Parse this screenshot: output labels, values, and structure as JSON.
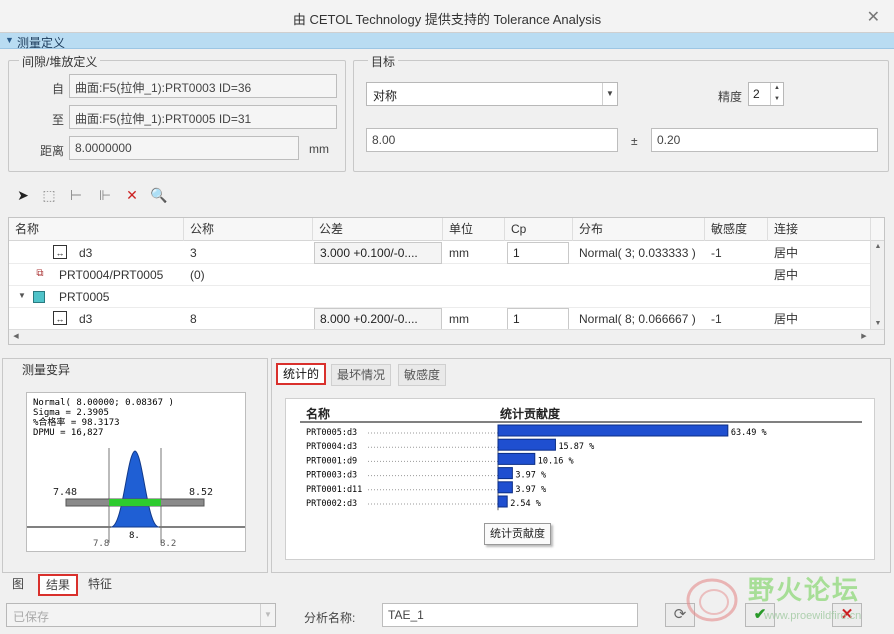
{
  "window": {
    "title": "由 CETOL Technology 提供支持的 Tolerance Analysis",
    "close": "✕"
  },
  "section": {
    "label": "测量定义"
  },
  "gap_def": {
    "legend": "间隙/堆放定义",
    "from_label": "自",
    "from_value": "曲面:F5(拉伸_1):PRT0003 ID=36",
    "to_label": "至",
    "to_value": "曲面:F5(拉伸_1):PRT0005 ID=31",
    "dist_label": "距离",
    "dist_value": "8.0000000",
    "dist_unit": "mm"
  },
  "target": {
    "legend": "目标",
    "mode": "对称",
    "precision_label": "精度",
    "precision_value": "2",
    "nominal": "8.00",
    "pm": "±",
    "tol": "0.20"
  },
  "table": {
    "headers": [
      "名称",
      "公称",
      "公差",
      "单位",
      "Cp",
      "分布",
      "敏感度",
      "连接"
    ],
    "rows": [
      {
        "name": "d3",
        "nominal": "3",
        "tol": "3.000 +0.100/-0....",
        "unit": "mm",
        "cp": "1",
        "dist": "Normal( 3; 0.033333 )",
        "sens": "-1",
        "conn": "居中"
      },
      {
        "name": "PRT0004/PRT0005",
        "nominal": "(0)",
        "tol": "",
        "unit": "",
        "cp": "",
        "dist": "",
        "sens": "",
        "conn": "居中"
      },
      {
        "name": "PRT0005",
        "nominal": "",
        "tol": "",
        "unit": "",
        "cp": "",
        "dist": "",
        "sens": "",
        "conn": ""
      },
      {
        "name": "d3",
        "nominal": "8",
        "tol": "8.000 +0.200/-0....",
        "unit": "mm",
        "cp": "1",
        "dist": "Normal( 8; 0.066667 )",
        "sens": "-1",
        "conn": "居中"
      }
    ]
  },
  "variation": {
    "legend": "测量变异",
    "lines": [
      "Normal( 8.00000; 0.08367 )",
      "Sigma  = 2.3905",
      "%合格率 = 98.3173",
      "DPMU   = 16,827"
    ],
    "lower_spec": "7.48",
    "upper_spec": "8.52",
    "ticks": [
      "7.8",
      "8.",
      "8.2"
    ]
  },
  "result_tabs": [
    "统计的",
    "最坏情况",
    "敏感度"
  ],
  "contrib": {
    "col_name": "名称",
    "col_value": "统计贡献度",
    "tooltip": "统计贡献度",
    "unit": "%"
  },
  "chart_data": {
    "type": "bar",
    "orientation": "horizontal",
    "categories": [
      "PRT0005:d3",
      "PRT0004:d3",
      "PRT0001:d9",
      "PRT0003:d3",
      "PRT0001:d11",
      "PRT0002:d3"
    ],
    "values": [
      63.49,
      15.87,
      10.16,
      3.97,
      3.97,
      2.54
    ],
    "labels": [
      "63.49 %",
      "15.87 %",
      "10.16 %",
      "3.97 %",
      "3.97 %",
      "2.54 %"
    ],
    "xlim": [
      0,
      100
    ],
    "color": "#1f4fd0"
  },
  "bottom_tabs": [
    "图",
    "结果",
    "特征"
  ],
  "footer": {
    "status": "已保存",
    "name_label": "分析名称:",
    "name_value": "TAE_1"
  },
  "watermark": {
    "cn": "野火论坛",
    "url": "www.proewildfire.cn"
  }
}
